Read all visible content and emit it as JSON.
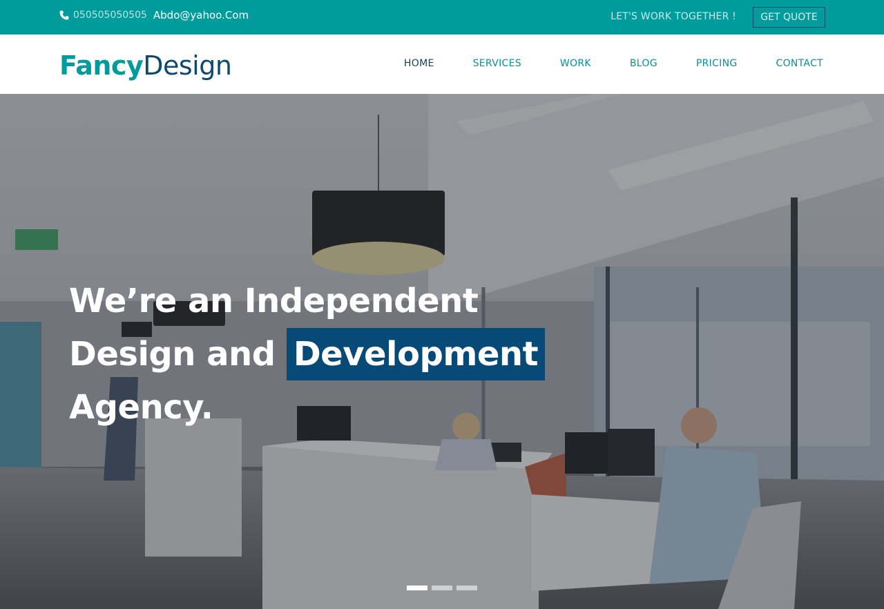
{
  "topbar": {
    "phone_icon": "phone-icon",
    "phone": "050505050505",
    "email": "Abdo@yahoo.Com",
    "together": "LET'S WORK TOGETHER !",
    "quote_label": "GET QUOTE",
    "background_color": "#009c9c"
  },
  "logo": {
    "part1": "Fancy",
    "part2": "Design",
    "color1": "#009c9c",
    "color2": "#0f4a6e"
  },
  "nav": {
    "items": [
      {
        "label": "HOME",
        "active": true
      },
      {
        "label": "SERVICES",
        "active": false
      },
      {
        "label": "WORK",
        "active": false
      },
      {
        "label": "BLOG",
        "active": false
      },
      {
        "label": "PRICING",
        "active": false
      },
      {
        "label": "CONTACT",
        "active": false
      }
    ]
  },
  "hero": {
    "line1": "We’re an Independent",
    "line2_a": "Design and",
    "line2_highlight": "Development",
    "line3": "Agency.",
    "highlight_color": "#074a78",
    "slides": {
      "count": 3,
      "active": 1
    }
  }
}
